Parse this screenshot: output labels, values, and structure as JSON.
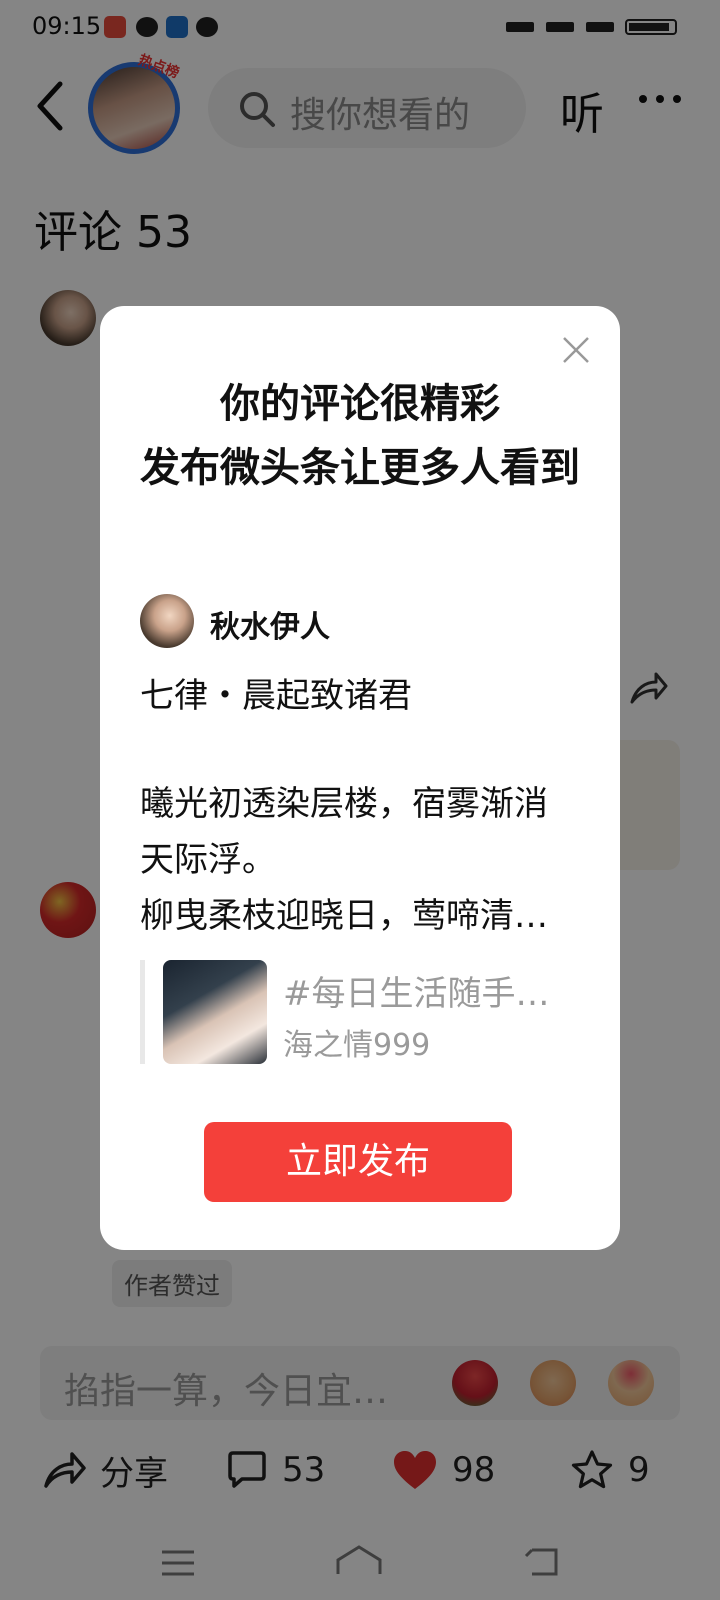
{
  "status_bar": {
    "time": "09:15"
  },
  "header": {
    "hot_badge": "热点榜",
    "search_placeholder": "搜你想看的",
    "listen_label": "听"
  },
  "comments": {
    "title": "评论 53",
    "author_chip": "作者赞过"
  },
  "comment_input": {
    "placeholder": "掐指一算，今日宜…"
  },
  "actions": {
    "share_label": "分享",
    "comment_count": "53",
    "like_count": "98",
    "favorite_count": "9"
  },
  "modal": {
    "title": "你的评论很精彩\n发布微头条让更多人看到",
    "author_name": "秋水伊人",
    "poem_title": "七律・晨起致诸君",
    "poem_body": "曦光初透染层楼，宿雾渐消天际浮。\n柳曳柔枝迎晓日，莺啼清…",
    "ref_title": "#每日生活随手…",
    "ref_author": "海之情999",
    "publish_label": "立即发布"
  },
  "colors": {
    "accent": "#f4403a",
    "like_red": "#e02e2e",
    "avatar_ring": "#2f6fd8"
  }
}
